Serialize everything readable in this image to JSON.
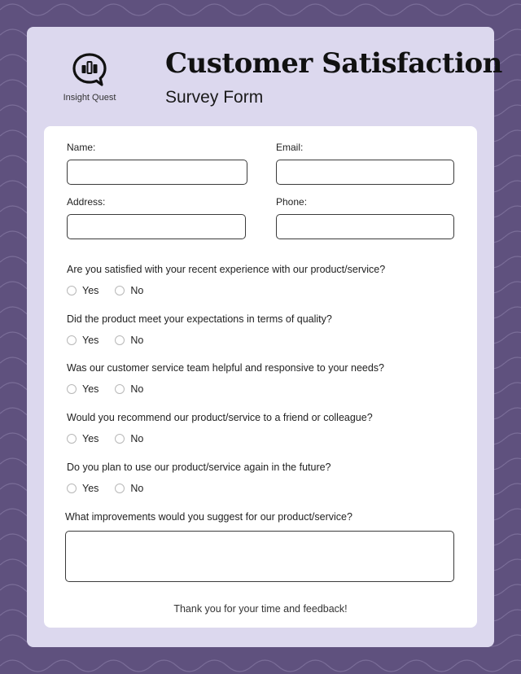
{
  "brand": {
    "logo_icon": "chat-bubble-bar-chart-icon",
    "name": "Insight Quest"
  },
  "header": {
    "title": "Customer Satisfaction",
    "subtitle": "Survey Form"
  },
  "colors": {
    "background": "#5f517e",
    "panel": "#dcd8ee",
    "card": "#ffffff",
    "text": "#1c1c1c"
  },
  "fields": {
    "name": {
      "label": "Name:",
      "value": "",
      "placeholder": ""
    },
    "email": {
      "label": "Email:",
      "value": "",
      "placeholder": ""
    },
    "address": {
      "label": "Address:",
      "value": "",
      "placeholder": ""
    },
    "phone": {
      "label": "Phone:",
      "value": "",
      "placeholder": ""
    }
  },
  "questions": [
    {
      "text": "Are you satisfied with your recent experience with our product/service?",
      "options": [
        "Yes",
        "No"
      ],
      "selected": null
    },
    {
      "text": "Did the product meet your expectations in terms of quality?",
      "options": [
        "Yes",
        "No"
      ],
      "selected": null
    },
    {
      "text": "Was our customer service team helpful and responsive to your needs?",
      "options": [
        "Yes",
        "No"
      ],
      "selected": null
    },
    {
      "text": "Would you recommend our product/service to a friend or colleague?",
      "options": [
        "Yes",
        "No"
      ],
      "selected": null
    },
    {
      "text": "Do you plan to use our product/service again in the future?",
      "options": [
        "Yes",
        "No"
      ],
      "selected": null
    }
  ],
  "improvements": {
    "label": "What improvements would you suggest for our product/service?",
    "value": ""
  },
  "footer": {
    "thanks": "Thank you for your time and feedback!"
  }
}
